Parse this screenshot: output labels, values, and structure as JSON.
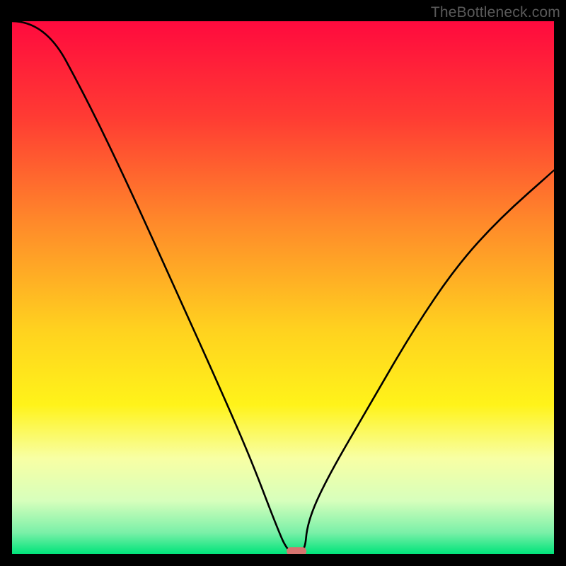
{
  "watermark": "TheBottleneck.com",
  "chart_data": {
    "type": "line",
    "title": "",
    "xlabel": "",
    "ylabel": "",
    "xlim": [
      0,
      100
    ],
    "ylim": [
      0,
      100
    ],
    "grid": false,
    "background": "rainbow-vertical-gradient",
    "series": [
      {
        "name": "bottleneck-curve",
        "x": [
          0,
          6,
          14,
          22,
          30,
          38,
          44,
          48.5,
          51,
          54,
          54.5,
          58,
          66,
          74,
          82,
          90,
          100
        ],
        "y": [
          100,
          100,
          85,
          68,
          50,
          32,
          18,
          6,
          0,
          0,
          6,
          14,
          28,
          42,
          54,
          63,
          72
        ]
      }
    ],
    "marker": {
      "name": "sweet-spot",
      "x": 52.5,
      "y": 0.5,
      "shape": "rounded-rect",
      "color": "#d6736f"
    },
    "gradient_stops": [
      {
        "offset": 0,
        "color": "#ff0a3e"
      },
      {
        "offset": 18,
        "color": "#ff3b33"
      },
      {
        "offset": 38,
        "color": "#ff8a2a"
      },
      {
        "offset": 58,
        "color": "#ffd21f"
      },
      {
        "offset": 72,
        "color": "#fff31a"
      },
      {
        "offset": 82,
        "color": "#f8ffa4"
      },
      {
        "offset": 90,
        "color": "#d7ffbc"
      },
      {
        "offset": 96,
        "color": "#7af0a8"
      },
      {
        "offset": 100,
        "color": "#00e37a"
      }
    ]
  }
}
